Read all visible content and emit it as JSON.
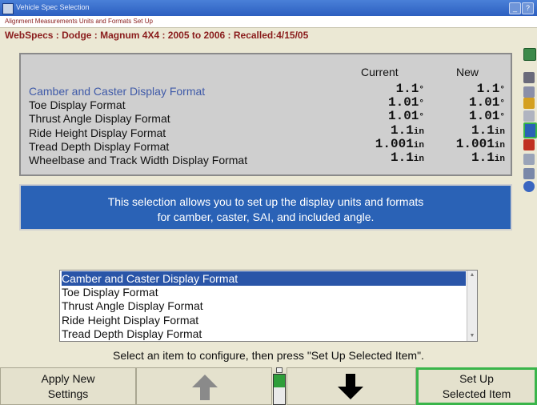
{
  "window": {
    "title": "Vehicle Spec Selection"
  },
  "subtitle": "Alignment Measurements Units and Formats Set Up",
  "vehicle_line": "WebSpecs : Dodge : Magnum 4X4 : 2005 to 2006 : Recalled:4/15/05",
  "columns": {
    "current": "Current",
    "new": "New"
  },
  "formats": [
    {
      "label": "Camber and Caster Display Format",
      "current": "1.1",
      "current_unit": "°",
      "new": "1.1",
      "new_unit": "°"
    },
    {
      "label": "Toe Display Format",
      "current": "1.01",
      "current_unit": "°",
      "new": "1.01",
      "new_unit": "°"
    },
    {
      "label": "Thrust Angle Display Format",
      "current": "1.01",
      "current_unit": "°",
      "new": "1.01",
      "new_unit": "°"
    },
    {
      "label": "Ride Height Display Format",
      "current": "1.1",
      "current_unit": "in",
      "new": "1.1",
      "new_unit": "in"
    },
    {
      "label": "Tread Depth Display Format",
      "current": "1.001",
      "current_unit": "in",
      "new": "1.001",
      "new_unit": "in"
    },
    {
      "label": "Wheelbase and Track Width Display Format",
      "current": "1.1",
      "current_unit": "in",
      "new": "1.1",
      "new_unit": "in"
    }
  ],
  "info": {
    "line1": "This selection allows you to set up the display units and formats",
    "line2": "for camber, caster, SAI, and included angle."
  },
  "list": {
    "items": [
      "Camber and Caster Display Format",
      "Toe Display Format",
      "Thrust Angle Display Format",
      "Ride Height Display Format",
      "Tread Depth Display Format"
    ],
    "selected_index": 0
  },
  "hint": "Select an item to configure, then press \"Set Up Selected Item\".",
  "buttons": {
    "apply_line1": "Apply New",
    "apply_line2": "Settings",
    "up_icon": "arrow-up-icon",
    "down_icon": "arrow-down-icon",
    "setup_line1": "Set Up",
    "setup_line2": "Selected Item"
  },
  "colors": {
    "accent_blue": "#2a62b6",
    "selection_blue": "#2a55a8",
    "title_red": "#8a1c1c",
    "active_green": "#39b54a"
  }
}
